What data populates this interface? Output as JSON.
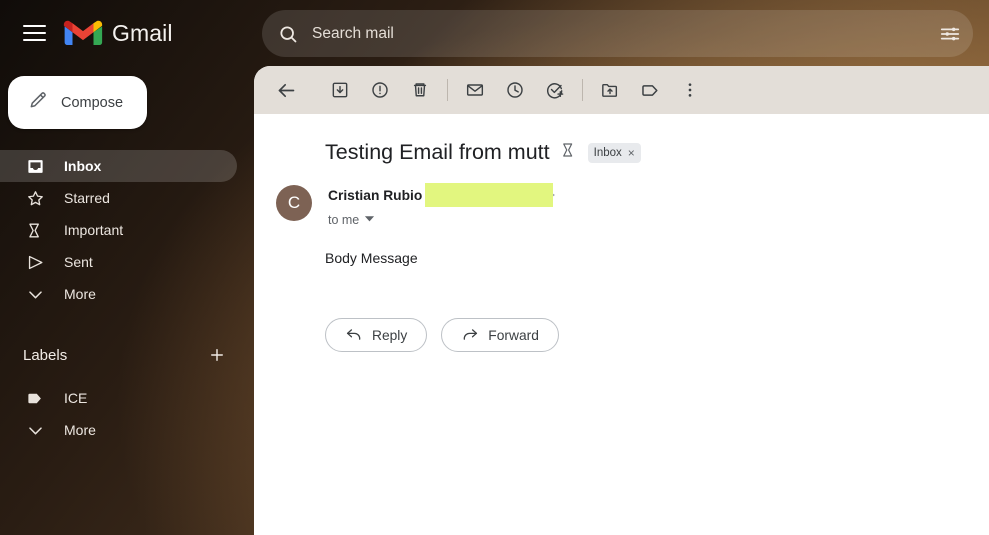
{
  "app": {
    "brand": "Gmail",
    "logo_colors": {
      "red": "#EA4335",
      "blue": "#4285F4",
      "green": "#34A853",
      "yellow": "#FBBC04",
      "white": "#FFFFFF"
    },
    "background_accent": "#7d5730"
  },
  "search": {
    "placeholder": "Search mail",
    "value": "",
    "search_icon": "search-icon",
    "options_icon": "tune-filter-icon"
  },
  "sidebar": {
    "menu_icon": "hamburger-menu-icon",
    "compose": {
      "label": "Compose",
      "icon": "pencil-icon"
    },
    "items": [
      {
        "label": "Inbox",
        "icon": "inbox-icon",
        "active": true
      },
      {
        "label": "Starred",
        "icon": "star-icon",
        "active": false
      },
      {
        "label": "Important",
        "icon": "important-label-icon",
        "active": false
      },
      {
        "label": "Sent",
        "icon": "send-icon",
        "active": false
      },
      {
        "label": "More",
        "icon": "chevron-down-icon",
        "active": false
      }
    ],
    "labels_section": {
      "title": "Labels",
      "add_icon": "plus-icon",
      "items": [
        {
          "label": "ICE",
          "icon": "label-tag-icon"
        },
        {
          "label": "More",
          "icon": "chevron-down-icon"
        }
      ]
    }
  },
  "toolbar": {
    "buttons": [
      {
        "name": "back-to-inbox",
        "icon": "arrow-left-icon"
      },
      {
        "name": "archive",
        "icon": "archive-icon"
      },
      {
        "name": "report-spam",
        "icon": "report-spam-icon"
      },
      {
        "name": "delete",
        "icon": "trash-icon"
      },
      {
        "name": "mark-as-unread",
        "icon": "envelope-icon"
      },
      {
        "name": "snooze",
        "icon": "clock-icon"
      },
      {
        "name": "add-to-tasks",
        "icon": "check-circle-plus-icon"
      },
      {
        "name": "move-to",
        "icon": "folder-move-icon"
      },
      {
        "name": "labels",
        "icon": "label-tag-icon"
      },
      {
        "name": "more-options",
        "icon": "more-vertical-icon"
      }
    ]
  },
  "email": {
    "subject": "Testing Email from mutt",
    "important_icon": "important-label-icon",
    "label_chip": {
      "text": "Inbox",
      "close": "×"
    },
    "sender": {
      "avatar_letter": "C",
      "avatar_color": "#7d6254",
      "name": "Cristian Rubio",
      "address_redacted": true,
      "redaction_color": "#e2f67f",
      "address_close_angle": ">"
    },
    "recipient": {
      "text": "to me",
      "expand_icon": "caret-down-icon"
    },
    "body": "Body Message",
    "actions": [
      {
        "label": "Reply",
        "icon": "reply-arrow-icon"
      },
      {
        "label": "Forward",
        "icon": "forward-arrow-icon"
      }
    ]
  }
}
